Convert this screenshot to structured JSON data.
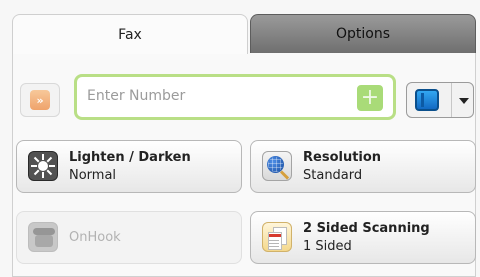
{
  "tabs": {
    "fax": "Fax",
    "options": "Options"
  },
  "number_input": {
    "placeholder": "Enter Number"
  },
  "buttons": {
    "lighten_darken": {
      "title": "Lighten / Darken",
      "value": "Normal"
    },
    "resolution": {
      "title": "Resolution",
      "value": "Standard"
    },
    "onhook": {
      "title": "OnHook"
    },
    "two_sided_scanning": {
      "title": "2 Sided Scanning",
      "value": "1 Sided"
    }
  },
  "icons": {
    "speed_dial": "speed-dial-icon",
    "add_recipient": "add-icon",
    "address_book": "address-book-icon",
    "dropdown": "chevron-down-icon",
    "lighten_darken": "brightness-icon",
    "resolution": "resolution-icon",
    "onhook": "phone-icon",
    "two_sided_scanning": "two-sided-scan-icon"
  },
  "colors": {
    "accent_green": "#b9df86",
    "active_tab_background": "#fbfbfb",
    "inactive_tab_background": "#8b8b8b"
  }
}
